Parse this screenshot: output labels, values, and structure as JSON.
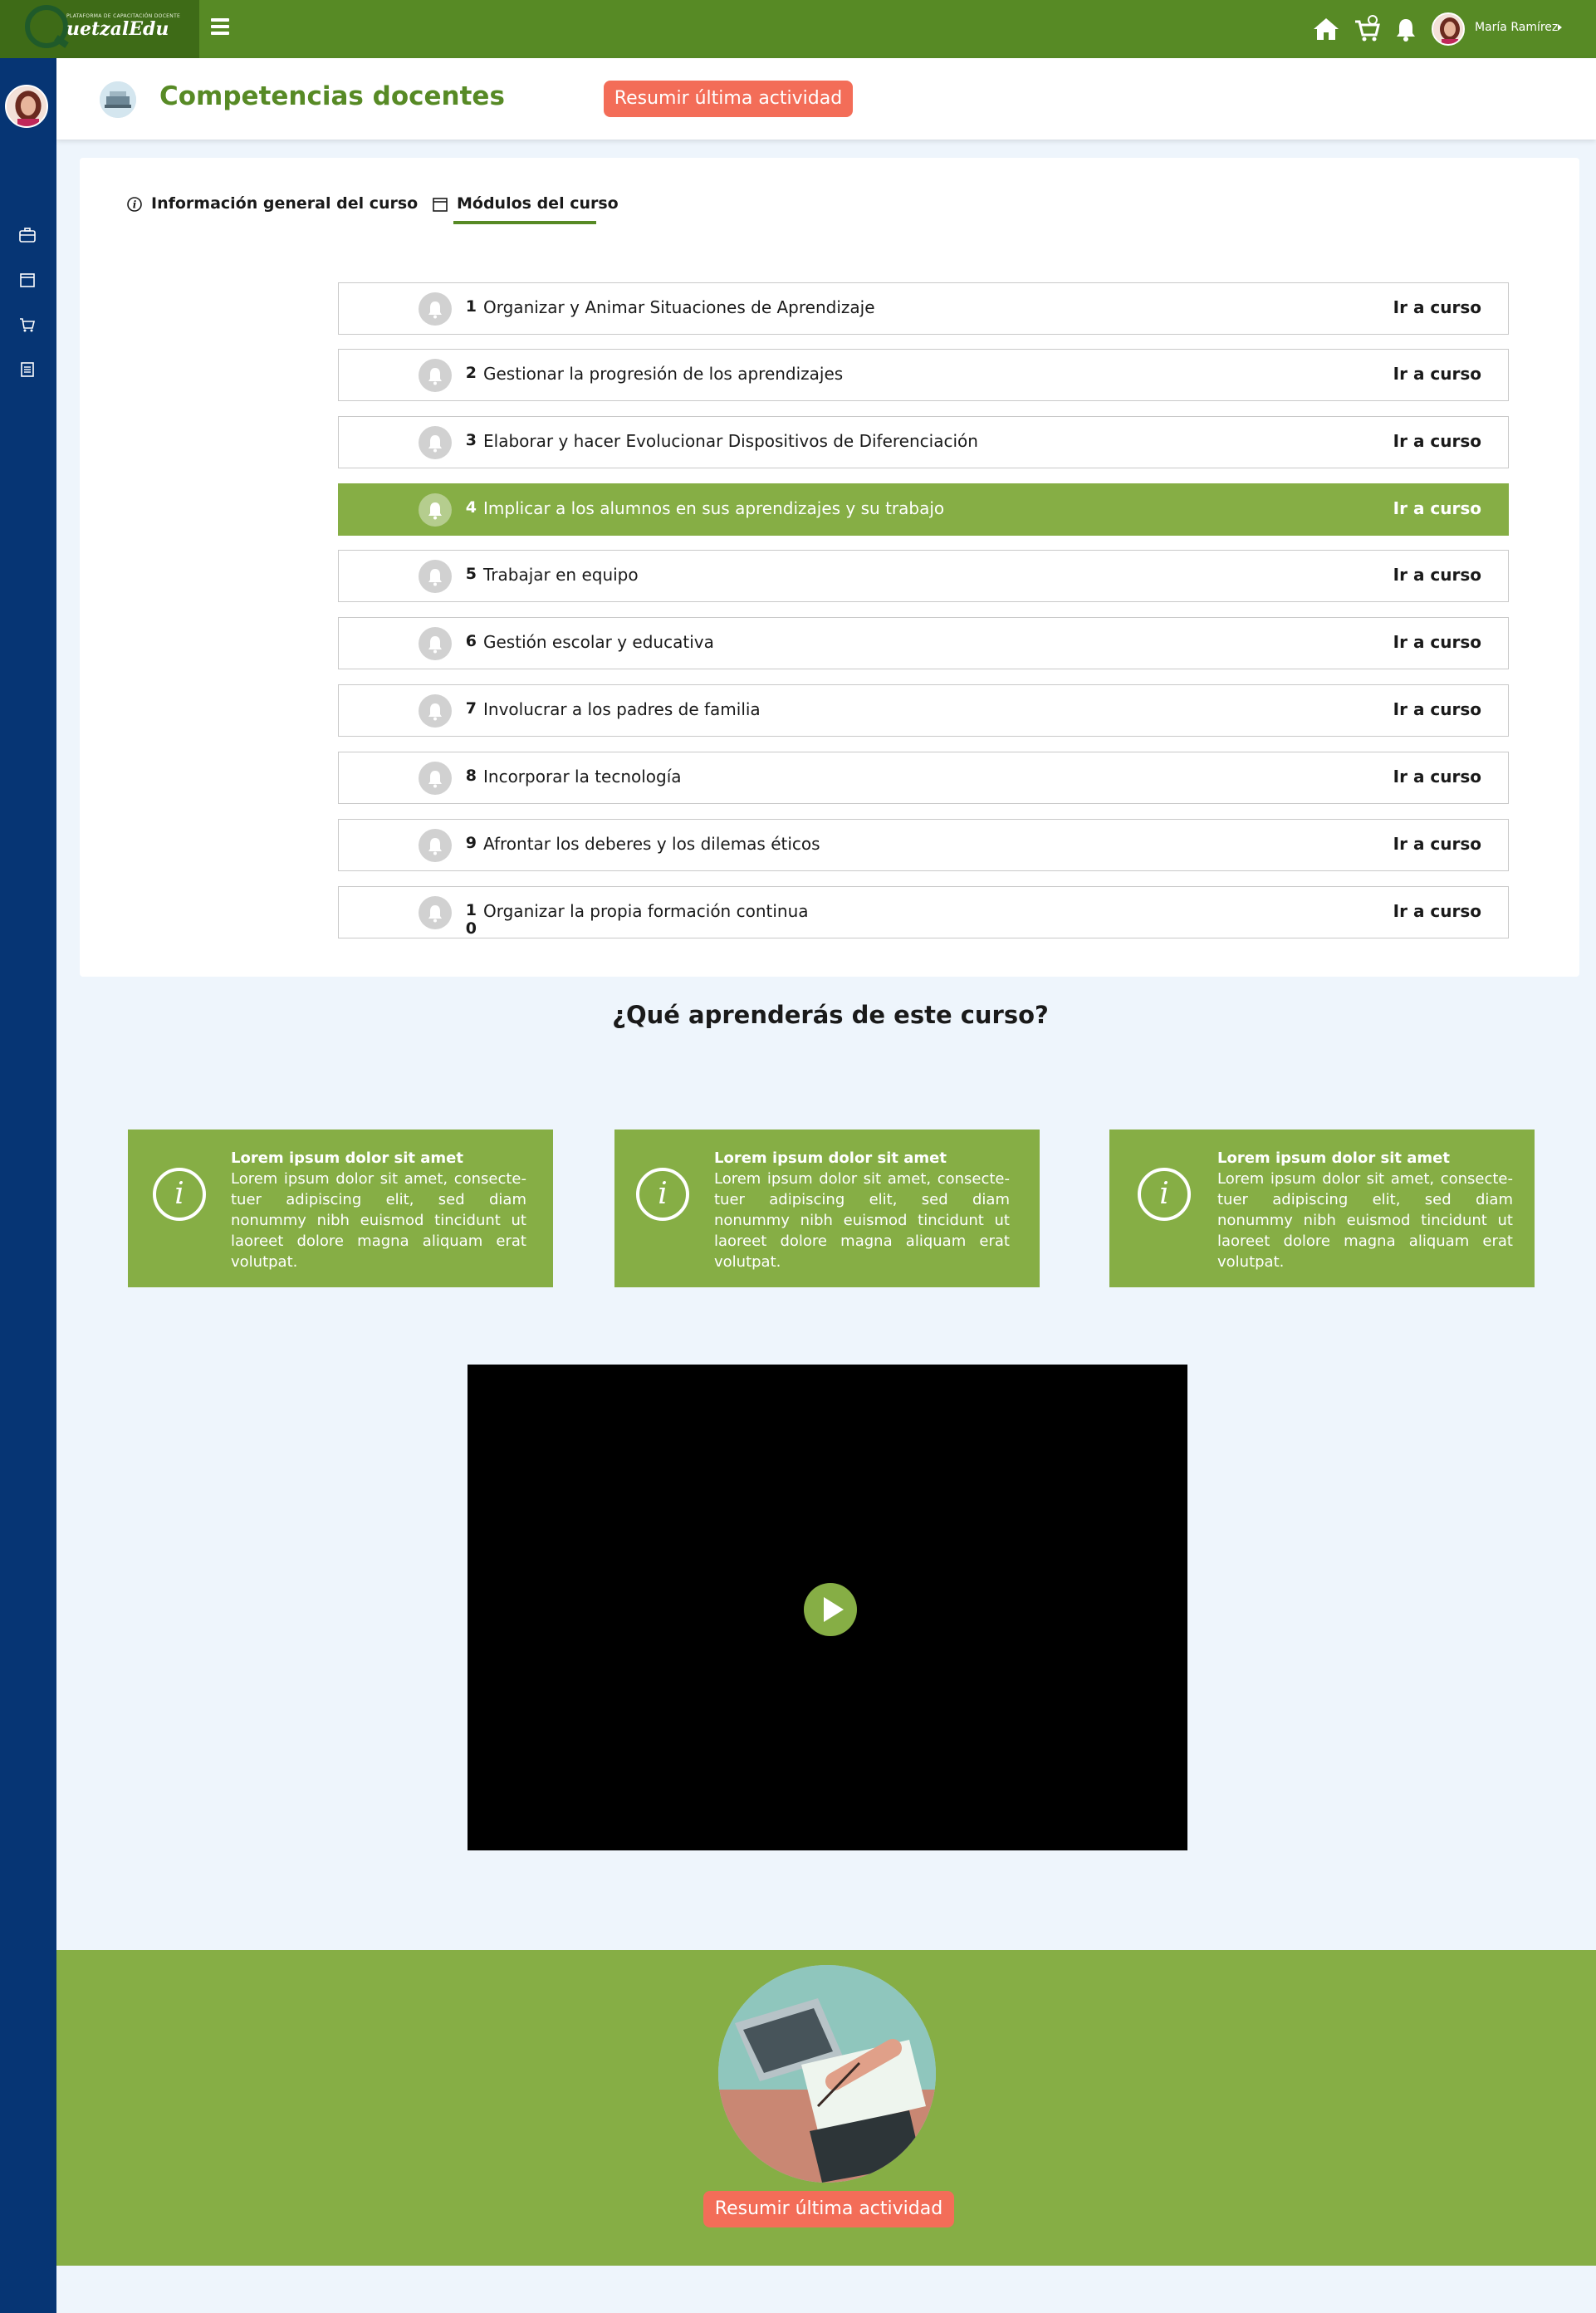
{
  "topbar": {
    "logo_small": "PLATAFORMA DE CAPACITACIÓN DOCENTE",
    "logo_text": "uetzalEdu",
    "user_name": "María Ramírez",
    "icons": [
      "menu-icon",
      "home-icon",
      "cart-icon",
      "bell-icon",
      "avatar",
      "caret-icon"
    ]
  },
  "sidebar": {
    "icons": [
      "briefcase-icon",
      "calendar-icon",
      "cart-icon",
      "document-icon"
    ]
  },
  "header": {
    "title": "Competencias docentes",
    "resume_button": "Resumir última actividad"
  },
  "tabs": [
    {
      "label": "Información general del curso",
      "icon": "info-icon"
    },
    {
      "label": "Módulos del curso",
      "icon": "calendar-icon",
      "active": true
    }
  ],
  "modules": [
    {
      "num": "1",
      "title": "Organizar y Animar Situaciones de Aprendizaje",
      "action": "Ir a curso"
    },
    {
      "num": "2",
      "title": "Gestionar la progresión de los aprendizajes",
      "action": "Ir a curso"
    },
    {
      "num": "3",
      "title": "Elaborar y hacer Evolucionar Dispositivos de Diferenciación",
      "action": "Ir a curso"
    },
    {
      "num": "4",
      "title": "Implicar a los alumnos en sus aprendizajes y su trabajo",
      "action": "Ir a curso"
    },
    {
      "num": "5",
      "title": "Trabajar en equipo",
      "action": "Ir a curso"
    },
    {
      "num": "6",
      "title": "Gestión escolar y educativa",
      "action": "Ir a curso"
    },
    {
      "num": "7",
      "title": "Involucrar a los padres de familia",
      "action": "Ir a curso"
    },
    {
      "num": "8",
      "title": "Incorporar la tecnología",
      "action": "Ir a curso"
    },
    {
      "num": "9",
      "title": "Afrontar los deberes y los dilemas éticos",
      "action": "Ir a curso"
    },
    {
      "num": "1 0",
      "title": "Organizar la propia formación continua",
      "action": "Ir a curso"
    }
  ],
  "learn": {
    "title": "¿Qué aprenderás de este curso?",
    "cards": [
      {
        "heading": "Lorem ipsum dolor sit amet",
        "body": "Lorem ipsum dolor sit amet, consecte-tuer adipiscing elit, sed diam nonummy nibh euismod tincidunt ut laoreet dolore magna aliquam erat volutpat."
      },
      {
        "heading": "Lorem ipsum dolor sit amet",
        "body": "Lorem ipsum dolor sit amet, consecte-tuer adipiscing elit, sed diam nonummy nibh euismod tincidunt ut laoreet dolore magna aliquam erat volutpat."
      },
      {
        "heading": "Lorem ipsum dolor sit amet",
        "body": "Lorem ipsum dolor sit amet, consecte-tuer adipiscing elit, sed diam nonummy nibh euismod tincidunt ut laoreet dolore magna aliquam erat volutpat."
      }
    ]
  },
  "video": {
    "icon": "play-icon"
  },
  "footer": {
    "resume_button": "Resumir última actividad"
  },
  "colors": {
    "topbar": "#578a25",
    "sidebar": "#063574",
    "accent_green": "#86ae45",
    "resume_button": "#f36d58",
    "title_green": "#578a25"
  }
}
